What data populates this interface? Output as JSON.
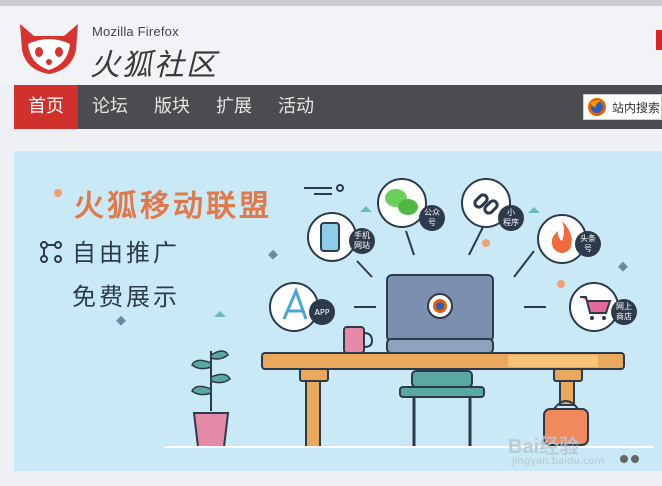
{
  "header": {
    "brand_en": "Mozilla Firefox",
    "brand_cn": "火狐社区"
  },
  "nav": {
    "items": [
      {
        "label": "首页",
        "active": true
      },
      {
        "label": "论坛"
      },
      {
        "label": "版块"
      },
      {
        "label": "扩展"
      },
      {
        "label": "活动"
      }
    ],
    "search_label": "站内搜索"
  },
  "banner": {
    "headline": "火狐移动联盟",
    "line1": "自由推广",
    "line2": "免费展示",
    "icons": [
      {
        "name": "mobile-site",
        "label1": "手机",
        "label2": "网站"
      },
      {
        "name": "wechat",
        "label1": "公众",
        "label2": "号"
      },
      {
        "name": "mini-program",
        "label1": "小",
        "label2": "程序"
      },
      {
        "name": "headline-account",
        "label1": "头条",
        "label2": "号"
      },
      {
        "name": "app-store",
        "label1": "APP",
        "label2": ""
      },
      {
        "name": "online-store",
        "label1": "网上",
        "label2": "商店"
      }
    ]
  },
  "watermark": {
    "text": "Bai经验",
    "url_text": "jingyan.baidu.com"
  },
  "colors": {
    "accent": "#d1312c",
    "nav_bg": "#4c4c50",
    "headline": "#e17a4b",
    "banner_bg": "#c9e9f7"
  }
}
